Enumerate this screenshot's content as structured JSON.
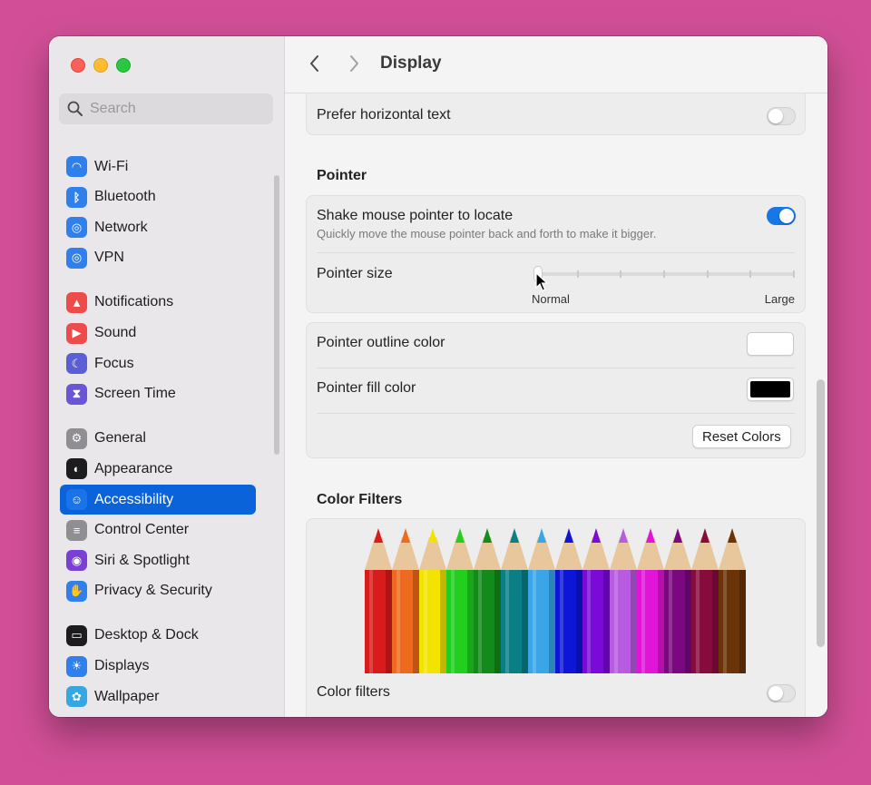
{
  "window": {
    "title": "Display"
  },
  "search": {
    "placeholder": "Search"
  },
  "sidebar": {
    "groups": [
      [
        {
          "label": "Wi-Fi",
          "icon": "wifi-icon",
          "color": "#2f80ed"
        },
        {
          "label": "Bluetooth",
          "icon": "bluetooth-icon",
          "color": "#2f80ed"
        },
        {
          "label": "Network",
          "icon": "globe-icon",
          "color": "#2f80ed"
        },
        {
          "label": "VPN",
          "icon": "vpn-globe-icon",
          "color": "#2f80ed"
        }
      ],
      [
        {
          "label": "Notifications",
          "icon": "bell-icon",
          "color": "#ee4b4b"
        },
        {
          "label": "Sound",
          "icon": "speaker-icon",
          "color": "#ee4b4b"
        },
        {
          "label": "Focus",
          "icon": "moon-icon",
          "color": "#5b5fd6"
        },
        {
          "label": "Screen Time",
          "icon": "hourglass-icon",
          "color": "#6a55d6"
        }
      ],
      [
        {
          "label": "General",
          "icon": "gear-icon",
          "color": "#8e8e93"
        },
        {
          "label": "Appearance",
          "icon": "appearance-icon",
          "color": "#1c1c1e"
        },
        {
          "label": "Accessibility",
          "icon": "accessibility-icon",
          "color": "#1a73e8"
        },
        {
          "label": "Control Center",
          "icon": "toggles-icon",
          "color": "#8e8e93"
        },
        {
          "label": "Siri & Spotlight",
          "icon": "siri-icon",
          "color": "#7a3fd6"
        },
        {
          "label": "Privacy & Security",
          "icon": "hand-icon",
          "color": "#2f80ed"
        }
      ],
      [
        {
          "label": "Desktop & Dock",
          "icon": "dock-icon",
          "color": "#1c1c1e"
        },
        {
          "label": "Displays",
          "icon": "sun-icon",
          "color": "#2f80ed"
        },
        {
          "label": "Wallpaper",
          "icon": "flower-icon",
          "color": "#36a7e0"
        }
      ]
    ],
    "active": "Accessibility"
  },
  "main": {
    "prefer_horizontal": {
      "label": "Prefer horizontal text",
      "on": false
    },
    "pointer_section": "Pointer",
    "shake": {
      "label": "Shake mouse pointer to locate",
      "sub": "Quickly move the mouse pointer back and forth to make it bigger.",
      "on": true
    },
    "pointer_size": {
      "label": "Pointer size",
      "min_label": "Normal",
      "max_label": "Large",
      "value": 0,
      "steps": 7
    },
    "outline_color": {
      "label": "Pointer outline color",
      "color": "#ffffff"
    },
    "fill_color": {
      "label": "Pointer fill color",
      "color": "#000000"
    },
    "reset_button": "Reset Colors",
    "color_filters_section": "Color Filters",
    "pencil_colors": [
      "#d81b1b",
      "#ee6a1f",
      "#f2e400",
      "#22cf1f",
      "#138a1a",
      "#0b7f86",
      "#3aa6e8",
      "#0d16d6",
      "#7a0bd6",
      "#b75be0",
      "#e015d8",
      "#7a087f",
      "#860c3e",
      "#6a3308"
    ],
    "color_filters_toggle": {
      "label": "Color filters",
      "on": false
    }
  }
}
